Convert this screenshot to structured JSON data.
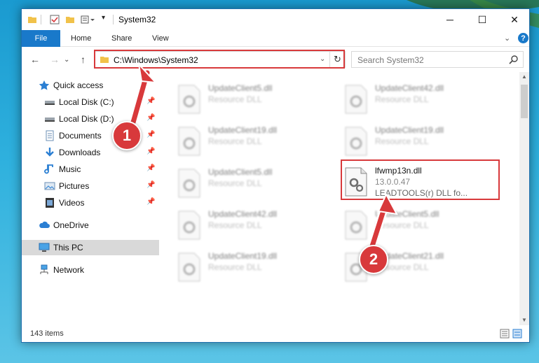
{
  "window": {
    "title": "System32",
    "controls": {
      "minimize": "─",
      "maximize": "☐",
      "close": "✕"
    }
  },
  "ribbon": {
    "tabs": [
      "File",
      "Home",
      "Share",
      "View"
    ],
    "help": "?"
  },
  "navigation": {
    "address": "C:\\Windows\\System32",
    "search_placeholder": "Search System32"
  },
  "sidebar": {
    "items": [
      {
        "label": "Quick access",
        "icon": "star-icon"
      },
      {
        "label": "Local Disk (C:)",
        "icon": "drive-icon",
        "pinned": true
      },
      {
        "label": "Local Disk (D:)",
        "icon": "drive-icon",
        "pinned": true
      },
      {
        "label": "Documents",
        "icon": "documents-icon",
        "pinned": true
      },
      {
        "label": "Downloads",
        "icon": "downloads-icon",
        "pinned": true
      },
      {
        "label": "Music",
        "icon": "music-icon",
        "pinned": true
      },
      {
        "label": "Pictures",
        "icon": "pictures-icon",
        "pinned": true
      },
      {
        "label": "Videos",
        "icon": "videos-icon",
        "pinned": true
      },
      {
        "label": "OneDrive",
        "icon": "cloud-icon"
      },
      {
        "label": "This PC",
        "icon": "computer-icon",
        "selected": true
      },
      {
        "label": "Network",
        "icon": "network-icon"
      }
    ]
  },
  "files": [
    {
      "name": "UpdateClient5.dll",
      "type": "Resource DLL",
      "blurred": true
    },
    {
      "name": "UpdateClient42.dll",
      "type": "Resource DLL",
      "blurred": true
    },
    {
      "name": "UpdateClient19.dll",
      "type": "Resource DLL",
      "blurred": true
    },
    {
      "name": "UpdateClient19.dll",
      "type": "Resource DLL",
      "blurred": true
    },
    {
      "name": "UpdateClient5.dll",
      "type": "Resource DLL",
      "blurred": true
    },
    {
      "name": "lfwmp13n.dll",
      "version": "13.0.0.47",
      "description": "LEADTOOLS(r) DLL fo...",
      "blurred": false
    },
    {
      "name": "UpdateClient42.dll",
      "type": "Resource DLL",
      "blurred": true
    },
    {
      "name": "UpdateClient5.dll",
      "type": "Resource DLL",
      "blurred": true
    },
    {
      "name": "UpdateClient19.dll",
      "type": "Resource DLL",
      "blurred": true
    },
    {
      "name": "UpdateClient21.dll",
      "type": "Resource DLL",
      "blurred": true
    }
  ],
  "status": {
    "item_count": "143 items"
  },
  "callouts": [
    "1",
    "2"
  ],
  "colors": {
    "accent": "#1979ca",
    "highlight": "#d8393b",
    "selected": "#d9d9d9"
  }
}
